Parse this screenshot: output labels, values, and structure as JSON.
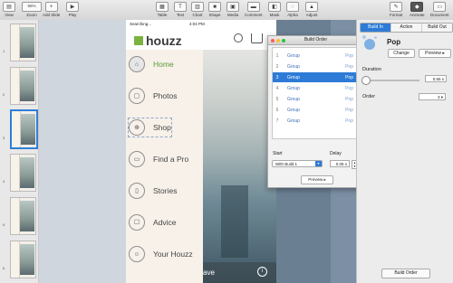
{
  "toolbar": {
    "view": "View",
    "zoom_value": "56%",
    "zoom": "Zoom",
    "add_slide": "Add Slide",
    "play": "Play",
    "table": "Table",
    "text": "Text",
    "chart": "Chart",
    "shape": "Shape",
    "media": "Media",
    "comment": "Comment",
    "mask": "Mask",
    "alpha": "Alpha",
    "adjust": "Adjust",
    "format": "Format",
    "animate": "Animate",
    "document": "Document"
  },
  "slides": [
    "1",
    "2",
    "3",
    "4",
    "5",
    "6"
  ],
  "phone": {
    "status_left": "Searching...",
    "status_time": "4:04 PM",
    "brand": "houzz",
    "menu": [
      "Home",
      "Photos",
      "Shop",
      "Find a Pro",
      "Stories",
      "Advice",
      "Your Houzz"
    ],
    "footer_text": "ave",
    "info": "i"
  },
  "build_order": {
    "title": "Build Order",
    "rows": [
      {
        "n": "1",
        "g": "Group",
        "p": "Pop"
      },
      {
        "n": "2",
        "g": "Group",
        "p": "Pop"
      },
      {
        "n": "3",
        "g": "Group",
        "p": "Pop"
      },
      {
        "n": "4",
        "g": "Group",
        "p": "Pop"
      },
      {
        "n": "5",
        "g": "Group",
        "p": "Pop"
      },
      {
        "n": "6",
        "g": "Group",
        "p": "Pop"
      },
      {
        "n": "7",
        "g": "Group",
        "p": "Pop"
      }
    ],
    "start_label": "Start",
    "delay_label": "Delay",
    "start_value": "With Build 1",
    "delay_value": "0.05 s",
    "preview": "Preview"
  },
  "inspector": {
    "tabs": [
      "Build In",
      "Action",
      "Build Out"
    ],
    "effect": "Pop",
    "change": "Change",
    "preview": "Preview",
    "duration_label": "Duration",
    "duration_value": "0.55 s",
    "order_label": "Order",
    "order_value": "3",
    "build_order_button": "Build Order"
  },
  "colors": {
    "accent": "#2d7bd7",
    "houzz_green": "#7ab33e"
  }
}
